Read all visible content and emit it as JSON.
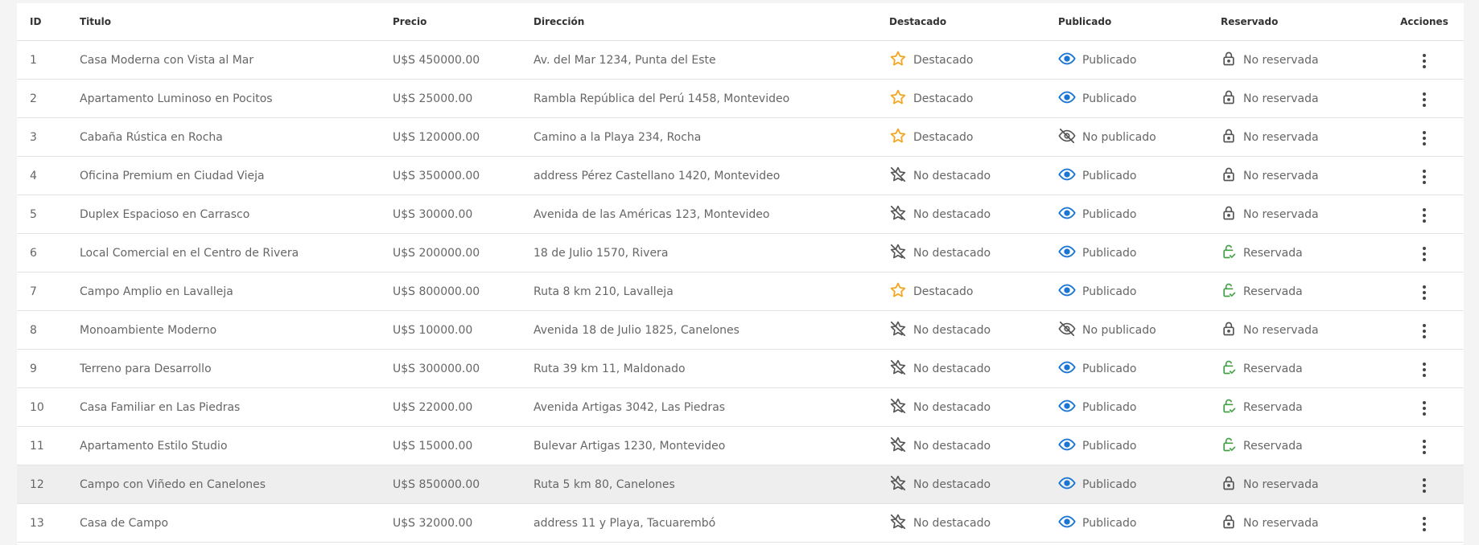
{
  "table": {
    "headers": {
      "id": "ID",
      "title": "Titulo",
      "price": "Precio",
      "address": "Dirección",
      "featured": "Destacado",
      "published": "Publicado",
      "reserved": "Reservado",
      "actions": "Acciones"
    },
    "rows": [
      {
        "id": "1",
        "title": "Casa Moderna con Vista al Mar",
        "price": "U$S 450000.00",
        "address": "Av. del Mar 1234, Punta del Este",
        "featured": "Destacado",
        "published": "Publicado",
        "reserved": "No reservada"
      },
      {
        "id": "2",
        "title": "Apartamento Luminoso en Pocitos",
        "price": "U$S 25000.00",
        "address": "Rambla República del Perú 1458, Montevideo",
        "featured": "Destacado",
        "published": "Publicado",
        "reserved": "No reservada"
      },
      {
        "id": "3",
        "title": "Cabaña Rústica en Rocha",
        "price": "U$S 120000.00",
        "address": "Camino a la Playa 234, Rocha",
        "featured": "Destacado",
        "published": "No publicado",
        "reserved": "No reservada"
      },
      {
        "id": "4",
        "title": "Oficina Premium en Ciudad Vieja",
        "price": "U$S 350000.00",
        "address": "address Pérez Castellano 1420, Montevideo",
        "featured": "No destacado",
        "published": "Publicado",
        "reserved": "No reservada"
      },
      {
        "id": "5",
        "title": "Duplex Espacioso en Carrasco",
        "price": "U$S 30000.00",
        "address": "Avenida de las Américas 123, Montevideo",
        "featured": "No destacado",
        "published": "Publicado",
        "reserved": "No reservada"
      },
      {
        "id": "6",
        "title": "Local Comercial en el Centro de Rivera",
        "price": "U$S 200000.00",
        "address": "18 de Julio 1570, Rivera",
        "featured": "No destacado",
        "published": "Publicado",
        "reserved": "Reservada"
      },
      {
        "id": "7",
        "title": "Campo Amplio en Lavalleja",
        "price": "U$S 800000.00",
        "address": "Ruta 8 km 210, Lavalleja",
        "featured": "Destacado",
        "published": "Publicado",
        "reserved": "Reservada"
      },
      {
        "id": "8",
        "title": "Monoambiente Moderno",
        "price": "U$S 10000.00",
        "address": "Avenida 18 de Julio 1825, Canelones",
        "featured": "No destacado",
        "published": "No publicado",
        "reserved": "No reservada"
      },
      {
        "id": "9",
        "title": "Terreno para Desarrollo",
        "price": "U$S 300000.00",
        "address": "Ruta 39 km 11, Maldonado",
        "featured": "No destacado",
        "published": "Publicado",
        "reserved": "Reservada"
      },
      {
        "id": "10",
        "title": "Casa Familiar en Las Piedras",
        "price": "U$S 22000.00",
        "address": "Avenida Artigas 3042, Las Piedras",
        "featured": "No destacado",
        "published": "Publicado",
        "reserved": "Reservada"
      },
      {
        "id": "11",
        "title": "Apartamento Estilo Studio",
        "price": "U$S 15000.00",
        "address": "Bulevar Artigas 1230, Montevideo",
        "featured": "No destacado",
        "published": "Publicado",
        "reserved": "Reservada"
      },
      {
        "id": "12",
        "title": "Campo con Viñedo en Canelones",
        "price": "U$S 850000.00",
        "address": "Ruta 5 km 80, Canelones",
        "featured": "No destacado",
        "published": "Publicado",
        "reserved": "No reservada"
      },
      {
        "id": "13",
        "title": "Casa de Campo",
        "price": "U$S 32000.00",
        "address": "address 11 y Playa, Tacuarembó",
        "featured": "No destacado",
        "published": "Publicado",
        "reserved": "No reservada"
      }
    ],
    "highlighted_row": "12"
  },
  "colors": {
    "featured_star": "#f5a623",
    "no_featured": "#555555",
    "published_eye": "#1976d2",
    "unpublished_eye": "#555555",
    "lock_locked": "#555555",
    "lock_reserved": "#43a047"
  },
  "icons": {
    "featured": "star-icon",
    "not_featured": "star-off-icon",
    "published": "eye-icon",
    "not_published": "eye-off-icon",
    "not_reserved": "lock-icon",
    "reserved": "lock-open-check-icon",
    "actions": "more-vertical-icon"
  }
}
